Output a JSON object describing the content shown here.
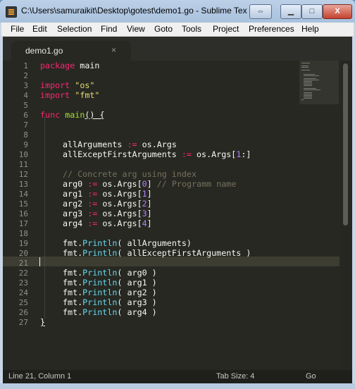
{
  "window": {
    "title": "C:\\Users\\samuraikit\\Desktop\\gotest\\demo1.go - Sublime Tex",
    "buttons": {
      "close": "X"
    }
  },
  "menu": [
    "File",
    "Edit",
    "Selection",
    "Find",
    "View",
    "Goto",
    "Tools",
    "Project",
    "Preferences",
    "Help"
  ],
  "tab": {
    "label": "demo1.go",
    "close": "×"
  },
  "line_numbers": [
    "1",
    "2",
    "3",
    "4",
    "5",
    "6",
    "7",
    "8",
    "9",
    "10",
    "11",
    "12",
    "13",
    "14",
    "15",
    "16",
    "17",
    "18",
    "19",
    "20",
    "21",
    "22",
    "23",
    "24",
    "25",
    "26",
    "27"
  ],
  "code": {
    "l1": {
      "kw": "package",
      "rest": " main"
    },
    "l3": {
      "kw": "import",
      "str": "\"os\""
    },
    "l4": {
      "kw": "import",
      "str": "\"fmt\""
    },
    "l6": {
      "kw": "func",
      "name": "main",
      "rest": "() {"
    },
    "l9": {
      "a": "allArguments",
      "op": ":=",
      "b": " os.Args"
    },
    "l10": {
      "a": "allExceptFirstArguments",
      "op": ":=",
      "b": " os.Args[",
      "num": "1",
      "c": ":]"
    },
    "l12": {
      "comment": "// Concrete arg using index"
    },
    "l13": {
      "a": "arg0",
      "op": ":=",
      "b": " os.Args[",
      "num": "0",
      "c": "]",
      "comment": "// Programm name"
    },
    "l14": {
      "a": "arg1",
      "op": ":=",
      "b": " os.Args[",
      "num": "1",
      "c": "]"
    },
    "l15": {
      "a": "arg2",
      "op": ":=",
      "b": " os.Args[",
      "num": "2",
      "c": "]"
    },
    "l16": {
      "a": "arg3",
      "op": ":=",
      "b": " os.Args[",
      "num": "3",
      "c": "]"
    },
    "l17": {
      "a": "arg4",
      "op": ":=",
      "b": " os.Args[",
      "num": "4",
      "c": "]"
    },
    "l19": {
      "obj": "fmt.",
      "fn": "Println",
      "args": "( allArguments)"
    },
    "l20": {
      "obj": "fmt.",
      "fn": "Println",
      "args": "( allExceptFirstArguments )"
    },
    "l22": {
      "obj": "fmt.",
      "fn": "Println",
      "args": "( arg0 )"
    },
    "l23": {
      "obj": "fmt.",
      "fn": "Println",
      "args": "( arg1 )"
    },
    "l24": {
      "obj": "fmt.",
      "fn": "Println",
      "args": "( arg2 )"
    },
    "l25": {
      "obj": "fmt.",
      "fn": "Println",
      "args": "( arg3 )"
    },
    "l26": {
      "obj": "fmt.",
      "fn": "Println",
      "args": "( arg4 )"
    },
    "l27": {
      "brace": "}"
    }
  },
  "status": {
    "position": "Line 21, Column 1",
    "tab_size": "Tab Size: 4",
    "syntax": "Go"
  },
  "colors": {
    "editor_bg": "#272822",
    "keyword": "#f92672",
    "string": "#e6db74",
    "function": "#a6e22e",
    "number": "#ae81ff",
    "comment": "#75715e",
    "call": "#66d9ef"
  }
}
